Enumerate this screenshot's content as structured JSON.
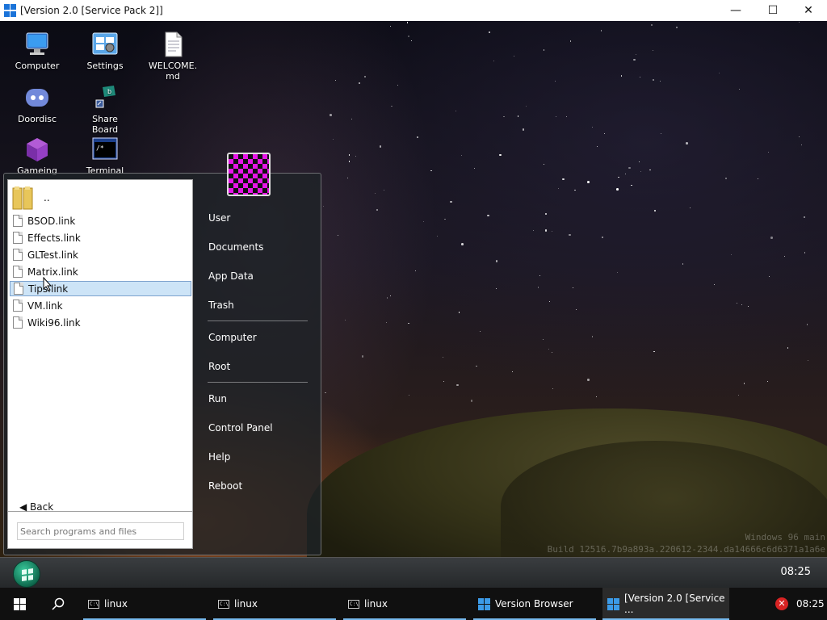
{
  "window": {
    "title": "[Version 2.0 [Service Pack 2]]",
    "minimize": "—",
    "maximize": "☐",
    "close": "✕"
  },
  "desktop_icons": [
    {
      "label": "Computer",
      "icon": "computer-icon"
    },
    {
      "label": "Settings",
      "icon": "settings-icon"
    },
    {
      "label": "WELCOME.\nmd",
      "icon": "document-icon"
    },
    {
      "label": "Doordisc",
      "icon": "discord-icon"
    },
    {
      "label": "Share\nBoard",
      "icon": "share-board-icon"
    },
    {
      "label": "Gameing",
      "icon": "cube-icon"
    },
    {
      "label": "Terminal",
      "icon": "terminal-icon"
    }
  ],
  "start_menu": {
    "parent_folder": "..",
    "files": [
      "BSOD.link",
      "Effects.link",
      "GLTest.link",
      "Matrix.link",
      "Tips.link",
      "VM.link",
      "Wiki96.link"
    ],
    "selected_file": "Tips.link",
    "back_label": "◀ Back",
    "search_placeholder": "Search programs and files",
    "right_items": [
      "User",
      "Documents",
      "App Data",
      "Trash",
      "Computer",
      "Root",
      "Run",
      "Control Panel",
      "Help",
      "Reboot"
    ]
  },
  "watermark": {
    "line1": "Windows 96 main",
    "line2": "Build 12516.7b9a893a.220612-2344.da14666c6d6371a1a6e"
  },
  "inner_taskbar": {
    "clock": "08:25"
  },
  "host_taskbar": {
    "items": [
      {
        "label": "linux",
        "icon": "cmd-icon"
      },
      {
        "label": "linux",
        "icon": "cmd-icon"
      },
      {
        "label": "linux",
        "icon": "cmd-icon"
      },
      {
        "label": "Version Browser",
        "icon": "windows-logo-icon"
      },
      {
        "label": "[Version 2.0 [Service ...",
        "icon": "windows-logo-icon"
      }
    ],
    "clock": "08:25",
    "accent_color": "#76b9ed"
  }
}
